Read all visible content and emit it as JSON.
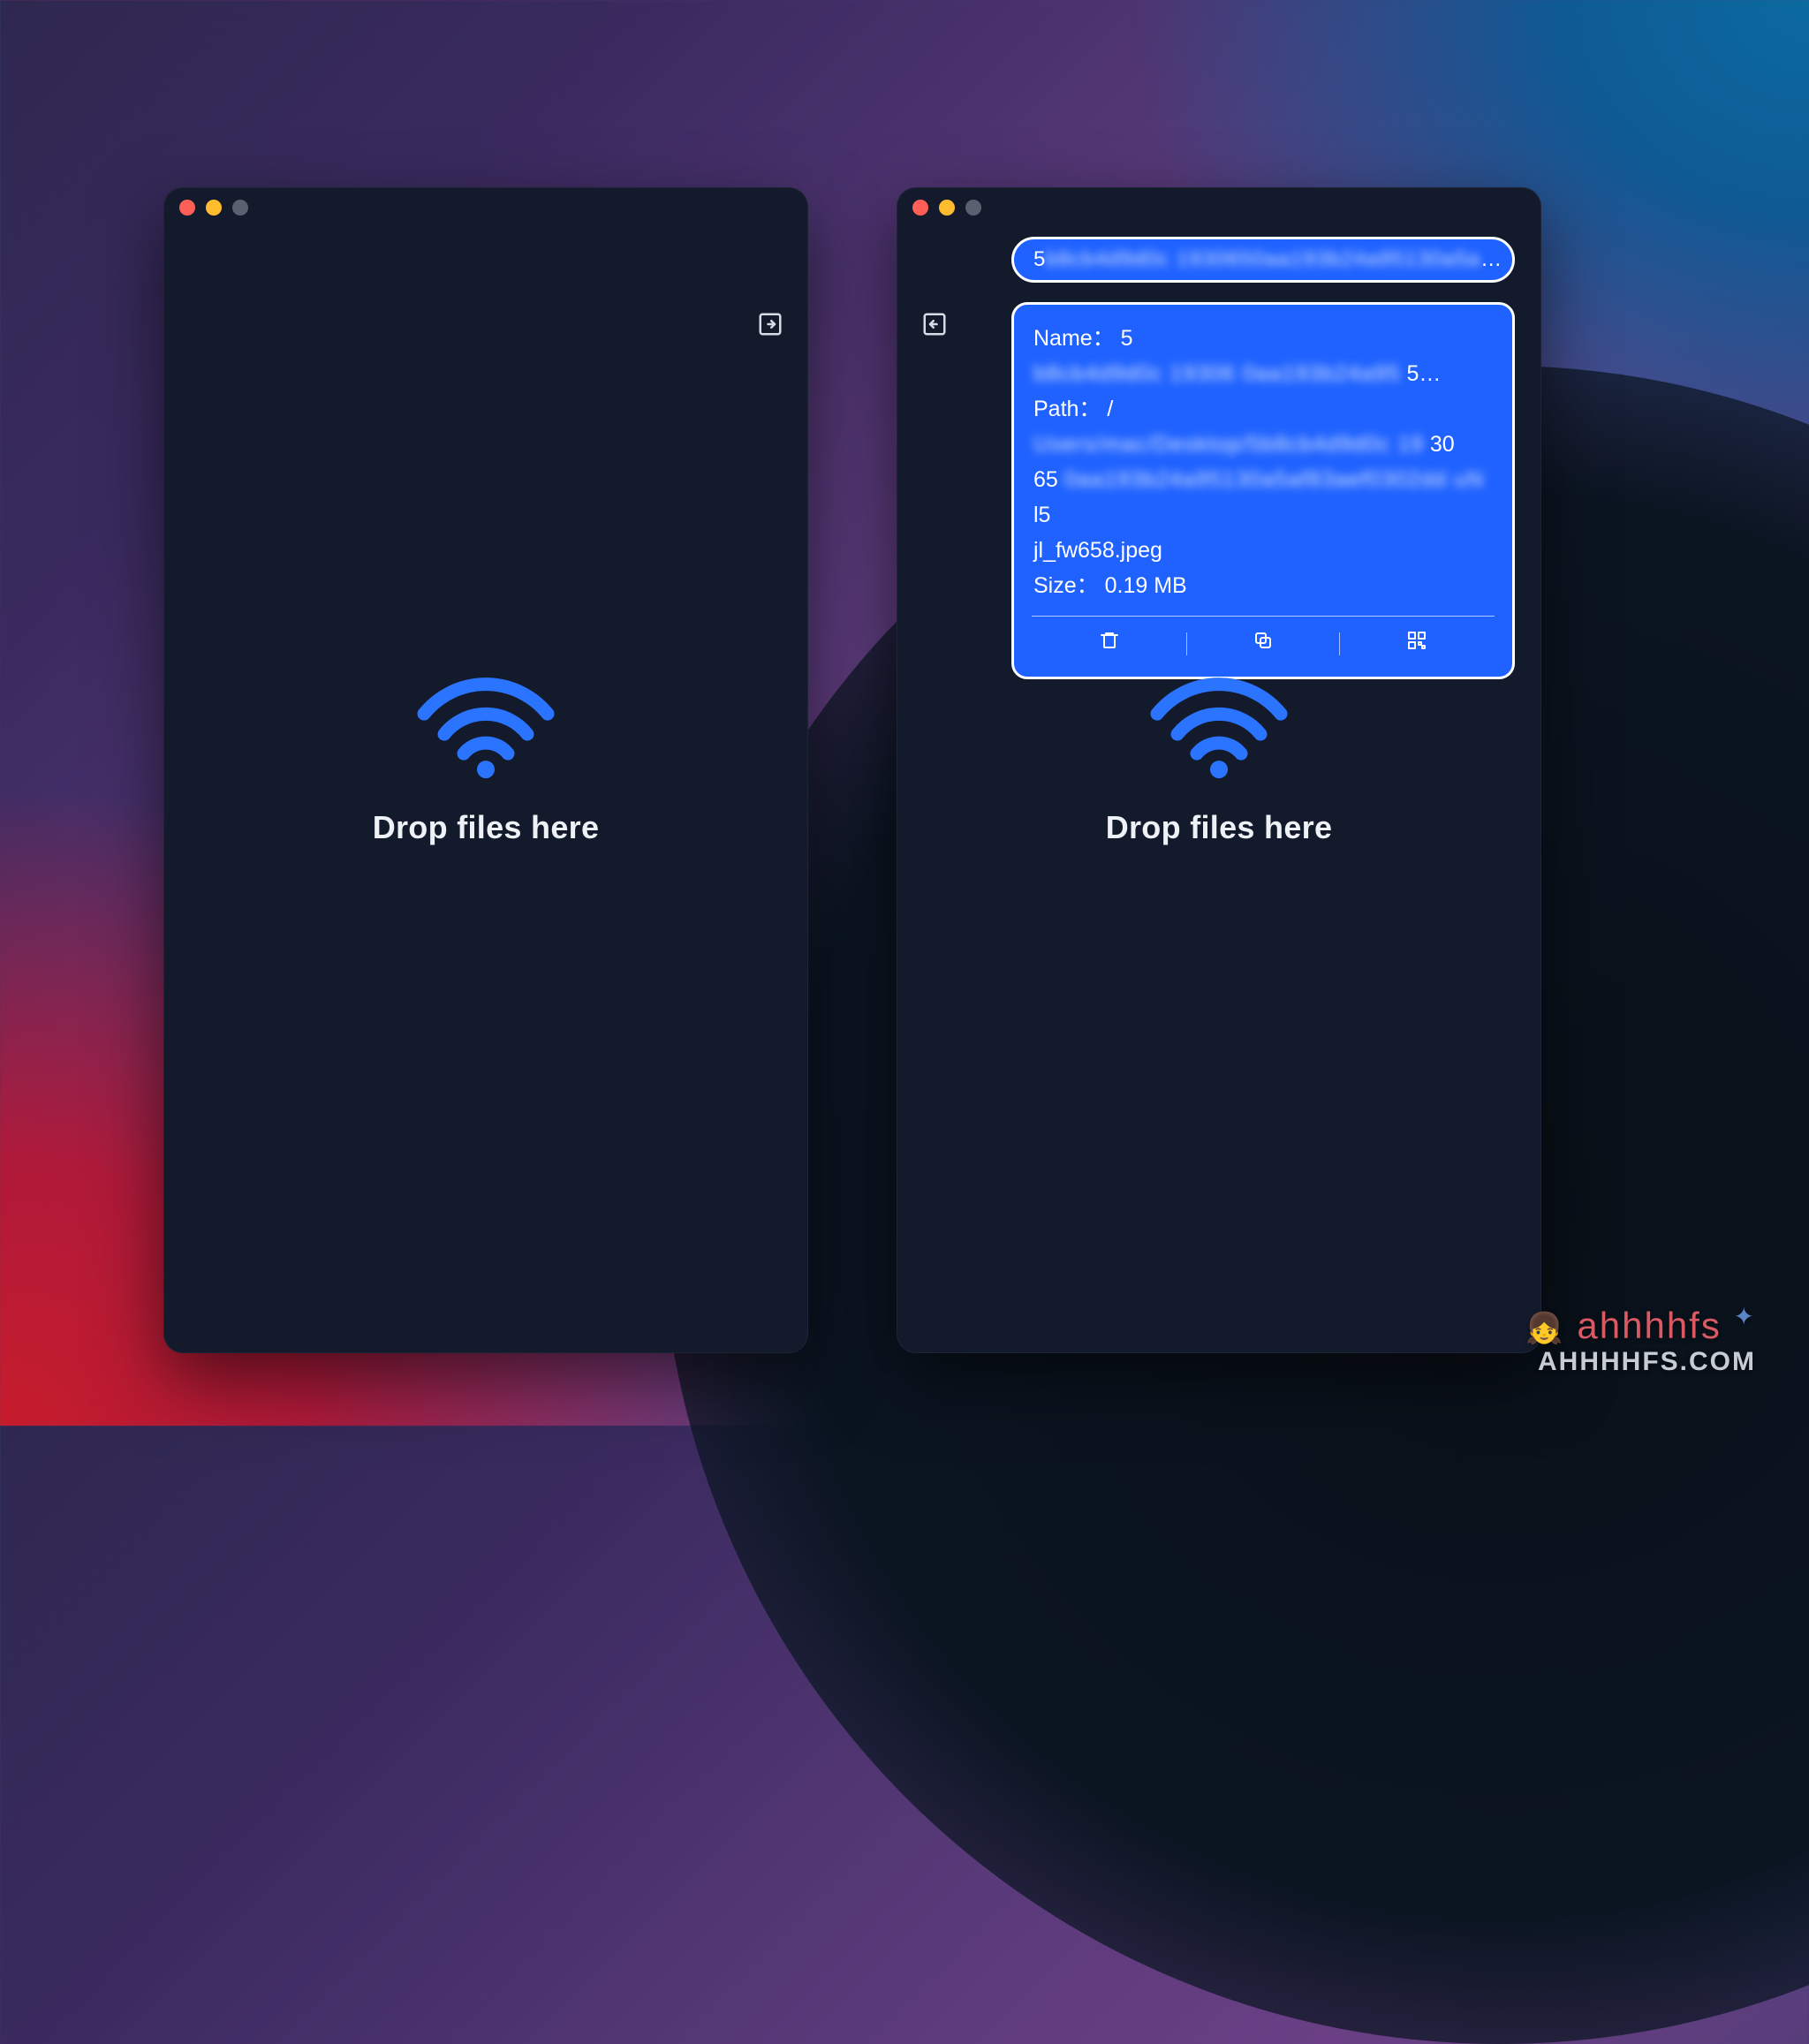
{
  "drop_label": "Drop files here",
  "pill": {
    "prefix": "5",
    "blurred": "b8cb4d9d0c 1930650aa193b24a95130a5a",
    "suffix": "…"
  },
  "file": {
    "name_label": "Name：",
    "name_prefix": "5",
    "name_blur": "b8cb4d9d0c 19306 0aa193b24a95",
    "name_suffix": "5…",
    "path_label": "Path：",
    "path_prefix": "/",
    "path_blur1": "Users/mac/Desktop/5b8cb4d9d0c 19",
    "path_mid1": "30",
    "path_line2_prefix": "65",
    "path_blur2": "0aa193b24a95130a5af83aef0302dd  uN",
    "path_mid2": "l5",
    "path_tail": "jl_fw658.jpeg",
    "size_label": "Size：",
    "size_value": "0.19 MB"
  },
  "watermark": {
    "line1": "ahhhhfs",
    "line2": "AHHHHFS.COM"
  }
}
